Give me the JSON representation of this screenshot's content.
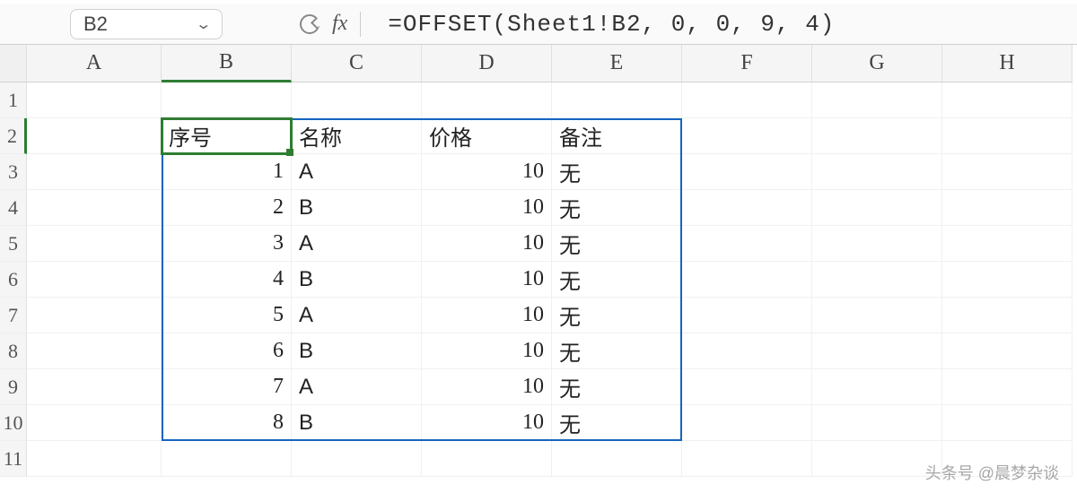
{
  "formula_bar": {
    "cell_ref": "B2",
    "formula": "=OFFSET(Sheet1!B2, 0, 0, 9, 4)",
    "fx_label": "fx"
  },
  "columns": [
    "A",
    "B",
    "C",
    "D",
    "E",
    "F",
    "G",
    "H"
  ],
  "rows": [
    "1",
    "2",
    "3",
    "4",
    "5",
    "6",
    "7",
    "8",
    "9",
    "10",
    "11"
  ],
  "active_column": "B",
  "active_row": "2",
  "selection": {
    "top_row": 2,
    "left_col": "B",
    "bottom_row": 10,
    "right_col": "E"
  },
  "table": {
    "headers": {
      "b": "序号",
      "c": "名称",
      "d": "价格",
      "e": "备注"
    },
    "rows": [
      {
        "b": "1",
        "c": "A",
        "d": "10",
        "e": "无"
      },
      {
        "b": "2",
        "c": "B",
        "d": "10",
        "e": "无"
      },
      {
        "b": "3",
        "c": "A",
        "d": "10",
        "e": "无"
      },
      {
        "b": "4",
        "c": "B",
        "d": "10",
        "e": "无"
      },
      {
        "b": "5",
        "c": "A",
        "d": "10",
        "e": "无"
      },
      {
        "b": "6",
        "c": "B",
        "d": "10",
        "e": "无"
      },
      {
        "b": "7",
        "c": "A",
        "d": "10",
        "e": "无"
      },
      {
        "b": "8",
        "c": "B",
        "d": "10",
        "e": "无"
      }
    ]
  },
  "watermark": "头条号 @晨梦杂谈"
}
